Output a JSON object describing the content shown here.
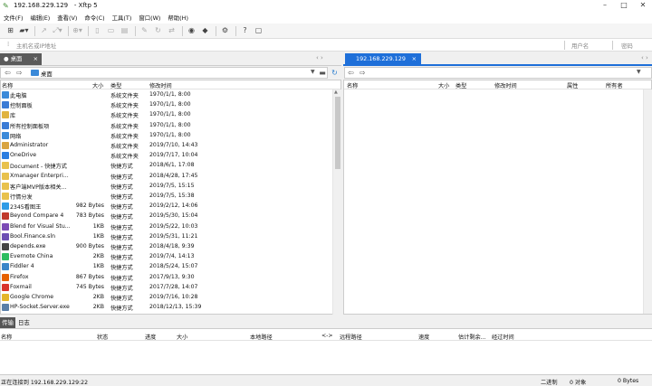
{
  "window": {
    "title": "192.168.229.129",
    "app": "- Xftp 5"
  },
  "menu": [
    "文件(F)",
    "编辑(E)",
    "查看(V)",
    "命令(C)",
    "工具(T)",
    "窗口(W)",
    "帮助(H)"
  ],
  "address": {
    "host_placeholder": "主机名或IP地址",
    "user_placeholder": "用户名",
    "password_placeholder": "密码"
  },
  "local_tab": {
    "label": "桌面",
    "close": "×"
  },
  "remote_tab": {
    "label": "192.168.229.129",
    "close": "×"
  },
  "local_path": "桌面",
  "columns_local": {
    "name": "名称",
    "size": "大小",
    "type": "类型",
    "modified": "修改时间"
  },
  "columns_remote": {
    "name": "名称",
    "size": "大小",
    "type": "类型",
    "modified": "修改时间",
    "attr": "属性",
    "owner": "所有者"
  },
  "files": [
    {
      "name": "此电脑",
      "size": "",
      "type": "系统文件夹",
      "modified": "1970/1/1, 8:00",
      "color": "#3b8ad9"
    },
    {
      "name": "控制面板",
      "size": "",
      "type": "系统文件夹",
      "modified": "1970/1/1, 8:00",
      "color": "#3a7bd5"
    },
    {
      "name": "库",
      "size": "",
      "type": "系统文件夹",
      "modified": "1970/1/1, 8:00",
      "color": "#e0b340"
    },
    {
      "name": "所有控制面板项",
      "size": "",
      "type": "系统文件夹",
      "modified": "1970/1/1, 8:00",
      "color": "#3a7bd5"
    },
    {
      "name": "网络",
      "size": "",
      "type": "系统文件夹",
      "modified": "1970/1/1, 8:00",
      "color": "#3b8ad9"
    },
    {
      "name": "Administrator",
      "size": "",
      "type": "系统文件夹",
      "modified": "2019/7/10, 14:43",
      "color": "#d9a441"
    },
    {
      "name": "OneDrive",
      "size": "",
      "type": "系统文件夹",
      "modified": "2019/7/17, 10:04",
      "color": "#2b7de0"
    },
    {
      "name": "Document - 快捷方式",
      "size": "",
      "type": "快捷方式",
      "modified": "2018/6/1, 17:08",
      "color": "#e8c14d"
    },
    {
      "name": "Xmanager Enterpri...",
      "size": "",
      "type": "快捷方式",
      "modified": "2018/4/28, 17:45",
      "color": "#e8c14d"
    },
    {
      "name": "客户端MVP版本相关...",
      "size": "",
      "type": "快捷方式",
      "modified": "2019/7/5, 15:15",
      "color": "#e8c14d"
    },
    {
      "name": "行情分发",
      "size": "",
      "type": "快捷方式",
      "modified": "2019/7/5, 15:38",
      "color": "#e8c14d"
    },
    {
      "name": "2345看图王",
      "size": "982 Bytes",
      "type": "快捷方式",
      "modified": "2019/2/12, 14:06",
      "color": "#2f9be6"
    },
    {
      "name": "Beyond Compare 4",
      "size": "783 Bytes",
      "type": "快捷方式",
      "modified": "2019/5/30, 15:04",
      "color": "#c0392b"
    },
    {
      "name": "Blend for Visual Stu...",
      "size": "1KB",
      "type": "快捷方式",
      "modified": "2019/5/22, 10:03",
      "color": "#7b4bb5"
    },
    {
      "name": "Bool.Finance.sln",
      "size": "1KB",
      "type": "快捷方式",
      "modified": "2019/5/31, 11:21",
      "color": "#6c4fb3"
    },
    {
      "name": "depends.exe",
      "size": "900 Bytes",
      "type": "快捷方式",
      "modified": "2018/4/18, 9:39",
      "color": "#444"
    },
    {
      "name": "Evernote China",
      "size": "2KB",
      "type": "快捷方式",
      "modified": "2019/7/4, 14:13",
      "color": "#2dbe60"
    },
    {
      "name": "Fiddler 4",
      "size": "1KB",
      "type": "快捷方式",
      "modified": "2018/5/24, 15:07",
      "color": "#3a86c8"
    },
    {
      "name": "Firefox",
      "size": "867 Bytes",
      "type": "快捷方式",
      "modified": "2017/9/13, 9:30",
      "color": "#e66000"
    },
    {
      "name": "Foxmail",
      "size": "745 Bytes",
      "type": "快捷方式",
      "modified": "2017/7/28, 14:07",
      "color": "#d9342b"
    },
    {
      "name": "Google Chrome",
      "size": "2KB",
      "type": "快捷方式",
      "modified": "2019/7/16, 10:28",
      "color": "#e4b52a"
    },
    {
      "name": "HP-Socket.Server.exe",
      "size": "2KB",
      "type": "快捷方式",
      "modified": "2018/12/13, 15:39",
      "color": "#5a7fa8"
    }
  ],
  "transfer_tabs": [
    "传输",
    "日志"
  ],
  "transfer_columns": {
    "name": "名称",
    "status": "状态",
    "progress": "进度",
    "size": "大小",
    "local_path": "本地路径",
    "arrow": "<->",
    "remote_path": "远程路径",
    "speed": "速度",
    "eta": "估计剩余...",
    "elapsed": "经过时间"
  },
  "status": {
    "left": "正在连接到 192.168.229.129:22",
    "mode": "二进制",
    "objects": "0 对象",
    "bytes": "0 Bytes"
  }
}
